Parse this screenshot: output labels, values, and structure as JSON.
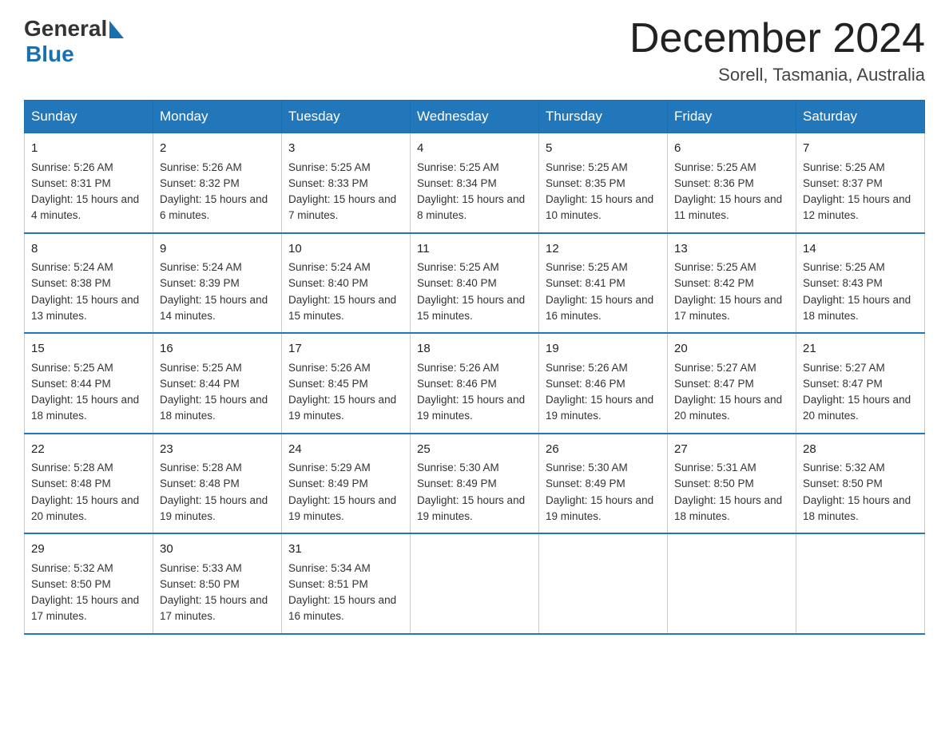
{
  "header": {
    "logo_general": "General",
    "logo_blue": "Blue",
    "month_year": "December 2024",
    "location": "Sorell, Tasmania, Australia"
  },
  "days_of_week": [
    "Sunday",
    "Monday",
    "Tuesday",
    "Wednesday",
    "Thursday",
    "Friday",
    "Saturday"
  ],
  "weeks": [
    [
      {
        "day": "1",
        "sunrise": "5:26 AM",
        "sunset": "8:31 PM",
        "daylight": "15 hours and 4 minutes."
      },
      {
        "day": "2",
        "sunrise": "5:26 AM",
        "sunset": "8:32 PM",
        "daylight": "15 hours and 6 minutes."
      },
      {
        "day": "3",
        "sunrise": "5:25 AM",
        "sunset": "8:33 PM",
        "daylight": "15 hours and 7 minutes."
      },
      {
        "day": "4",
        "sunrise": "5:25 AM",
        "sunset": "8:34 PM",
        "daylight": "15 hours and 8 minutes."
      },
      {
        "day": "5",
        "sunrise": "5:25 AM",
        "sunset": "8:35 PM",
        "daylight": "15 hours and 10 minutes."
      },
      {
        "day": "6",
        "sunrise": "5:25 AM",
        "sunset": "8:36 PM",
        "daylight": "15 hours and 11 minutes."
      },
      {
        "day": "7",
        "sunrise": "5:25 AM",
        "sunset": "8:37 PM",
        "daylight": "15 hours and 12 minutes."
      }
    ],
    [
      {
        "day": "8",
        "sunrise": "5:24 AM",
        "sunset": "8:38 PM",
        "daylight": "15 hours and 13 minutes."
      },
      {
        "day": "9",
        "sunrise": "5:24 AM",
        "sunset": "8:39 PM",
        "daylight": "15 hours and 14 minutes."
      },
      {
        "day": "10",
        "sunrise": "5:24 AM",
        "sunset": "8:40 PM",
        "daylight": "15 hours and 15 minutes."
      },
      {
        "day": "11",
        "sunrise": "5:25 AM",
        "sunset": "8:40 PM",
        "daylight": "15 hours and 15 minutes."
      },
      {
        "day": "12",
        "sunrise": "5:25 AM",
        "sunset": "8:41 PM",
        "daylight": "15 hours and 16 minutes."
      },
      {
        "day": "13",
        "sunrise": "5:25 AM",
        "sunset": "8:42 PM",
        "daylight": "15 hours and 17 minutes."
      },
      {
        "day": "14",
        "sunrise": "5:25 AM",
        "sunset": "8:43 PM",
        "daylight": "15 hours and 18 minutes."
      }
    ],
    [
      {
        "day": "15",
        "sunrise": "5:25 AM",
        "sunset": "8:44 PM",
        "daylight": "15 hours and 18 minutes."
      },
      {
        "day": "16",
        "sunrise": "5:25 AM",
        "sunset": "8:44 PM",
        "daylight": "15 hours and 18 minutes."
      },
      {
        "day": "17",
        "sunrise": "5:26 AM",
        "sunset": "8:45 PM",
        "daylight": "15 hours and 19 minutes."
      },
      {
        "day": "18",
        "sunrise": "5:26 AM",
        "sunset": "8:46 PM",
        "daylight": "15 hours and 19 minutes."
      },
      {
        "day": "19",
        "sunrise": "5:26 AM",
        "sunset": "8:46 PM",
        "daylight": "15 hours and 19 minutes."
      },
      {
        "day": "20",
        "sunrise": "5:27 AM",
        "sunset": "8:47 PM",
        "daylight": "15 hours and 20 minutes."
      },
      {
        "day": "21",
        "sunrise": "5:27 AM",
        "sunset": "8:47 PM",
        "daylight": "15 hours and 20 minutes."
      }
    ],
    [
      {
        "day": "22",
        "sunrise": "5:28 AM",
        "sunset": "8:48 PM",
        "daylight": "15 hours and 20 minutes."
      },
      {
        "day": "23",
        "sunrise": "5:28 AM",
        "sunset": "8:48 PM",
        "daylight": "15 hours and 19 minutes."
      },
      {
        "day": "24",
        "sunrise": "5:29 AM",
        "sunset": "8:49 PM",
        "daylight": "15 hours and 19 minutes."
      },
      {
        "day": "25",
        "sunrise": "5:30 AM",
        "sunset": "8:49 PM",
        "daylight": "15 hours and 19 minutes."
      },
      {
        "day": "26",
        "sunrise": "5:30 AM",
        "sunset": "8:49 PM",
        "daylight": "15 hours and 19 minutes."
      },
      {
        "day": "27",
        "sunrise": "5:31 AM",
        "sunset": "8:50 PM",
        "daylight": "15 hours and 18 minutes."
      },
      {
        "day": "28",
        "sunrise": "5:32 AM",
        "sunset": "8:50 PM",
        "daylight": "15 hours and 18 minutes."
      }
    ],
    [
      {
        "day": "29",
        "sunrise": "5:32 AM",
        "sunset": "8:50 PM",
        "daylight": "15 hours and 17 minutes."
      },
      {
        "day": "30",
        "sunrise": "5:33 AM",
        "sunset": "8:50 PM",
        "daylight": "15 hours and 17 minutes."
      },
      {
        "day": "31",
        "sunrise": "5:34 AM",
        "sunset": "8:51 PM",
        "daylight": "15 hours and 16 minutes."
      },
      null,
      null,
      null,
      null
    ]
  ],
  "labels": {
    "sunrise_prefix": "Sunrise: ",
    "sunset_prefix": "Sunset: ",
    "daylight_prefix": "Daylight: "
  }
}
